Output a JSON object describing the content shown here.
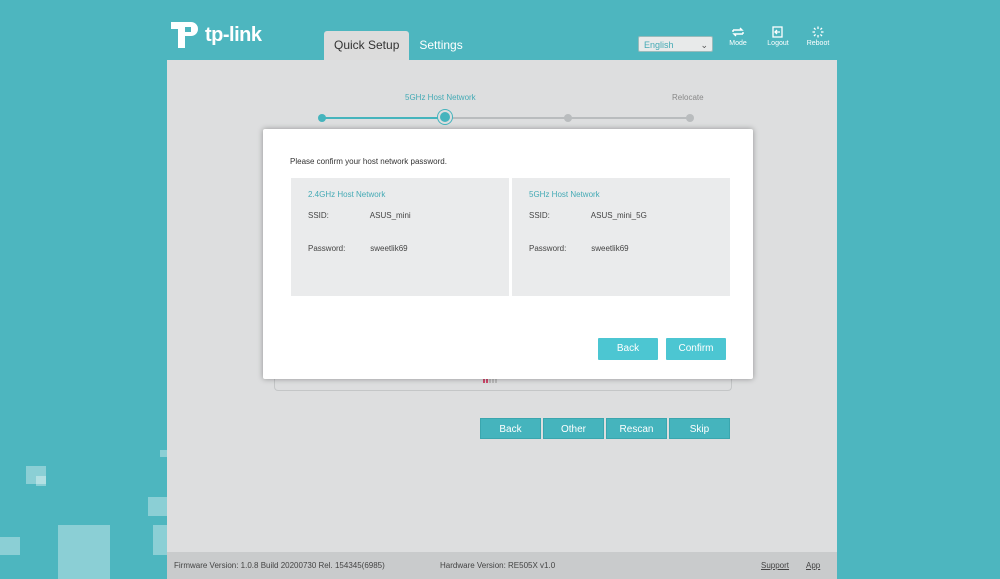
{
  "brand": {
    "name": "tp-link"
  },
  "tabs": [
    {
      "label": "Quick Setup",
      "active": true
    },
    {
      "label": "Settings",
      "active": false
    }
  ],
  "language": {
    "selected": "English"
  },
  "header_actions": [
    {
      "label": "Mode",
      "icon": "mode-icon"
    },
    {
      "label": "Logout",
      "icon": "logout-icon"
    },
    {
      "label": "Reboot",
      "icon": "reboot-icon"
    }
  ],
  "stepper": {
    "labels": {
      "current": "5GHz Host Network",
      "last": "Relocate"
    }
  },
  "modal": {
    "message": "Please confirm your host network password.",
    "networks": [
      {
        "title": "2.4GHz Host Network",
        "ssid_label": "SSID:",
        "ssid": "ASUS_mini",
        "password_label": "Password:",
        "password": "sweetlik69"
      },
      {
        "title": "5GHz Host Network",
        "ssid_label": "SSID:",
        "ssid": "ASUS_mini_5G",
        "password_label": "Password:",
        "password": "sweetlik69"
      }
    ],
    "back_label": "Back",
    "confirm_label": "Confirm"
  },
  "actions": {
    "back_label": "Back",
    "other_label": "Other",
    "rescan_label": "Rescan",
    "skip_label": "Skip"
  },
  "footer": {
    "firmware": "Firmware Version: 1.0.8 Build 20200730 Rel. 154345(6985)",
    "hardware": "Hardware Version: RE505X v1.0",
    "support_label": "Support",
    "app_label": "App"
  },
  "colors": {
    "background": "#4db6bf",
    "accent": "#45b4bd",
    "panel": "#dddedf"
  }
}
